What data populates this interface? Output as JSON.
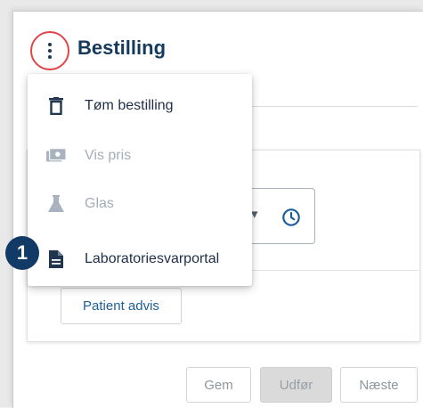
{
  "header": {
    "title": "Bestilling"
  },
  "menu": {
    "items": [
      {
        "label": "Tøm bestilling",
        "icon": "trash-icon",
        "enabled": true
      },
      {
        "label": "Vis pris",
        "icon": "money-icon",
        "enabled": false
      },
      {
        "label": "Glas",
        "icon": "flask-icon",
        "enabled": false
      },
      {
        "label": "Laboratoriesvarportal",
        "icon": "document-icon",
        "enabled": true
      }
    ]
  },
  "annotation": {
    "badge": "1"
  },
  "card": {
    "patient_button": "Patient advis"
  },
  "footer": {
    "save": "Gem",
    "execute": "Udfør",
    "next": "Næste"
  },
  "colors": {
    "accent": "#163a5c",
    "link": "#1d5e98",
    "highlight": "#e0454a",
    "badge": "#123a66"
  }
}
